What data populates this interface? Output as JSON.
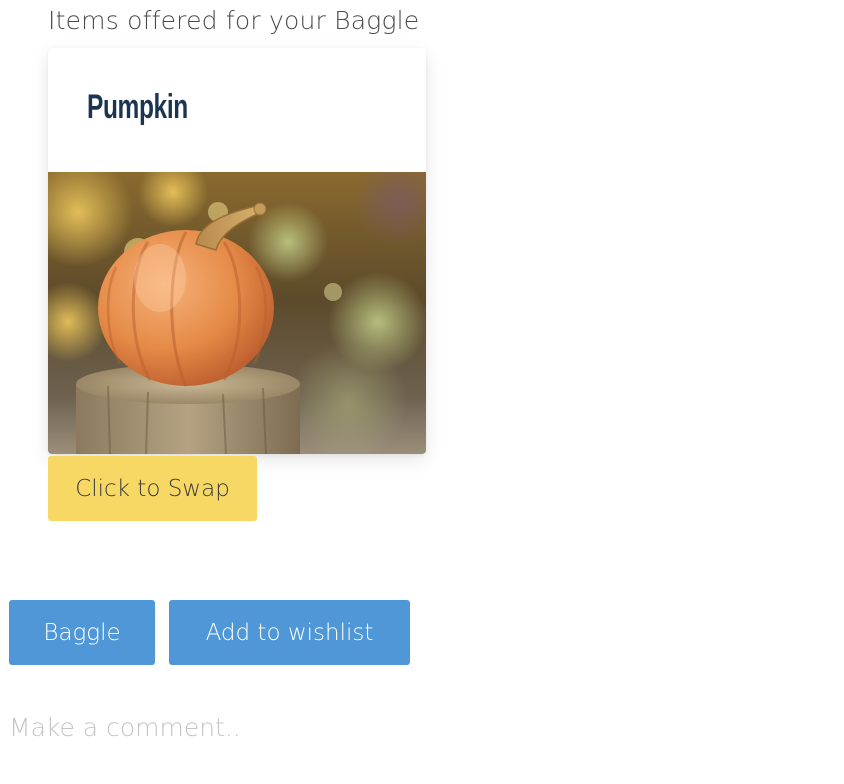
{
  "offered_items": {
    "heading": "Items offered for your Baggle",
    "items": [
      {
        "title": "Pumpkin",
        "photo": "pumpkin-on-wooden-stump-photo",
        "swap_label": "Click to Swap"
      }
    ]
  },
  "actions": {
    "baggle_label": "Baggle",
    "wishlist_label": "Add to wishlist"
  },
  "comment": {
    "placeholder": "Make a comment..",
    "value": ""
  },
  "colors": {
    "swap_button": "#f7d864",
    "primary_button": "#4f97d6",
    "item_title": "#1b3550",
    "heading_text": "#4a4a4a",
    "placeholder_text": "#c4c4c4"
  }
}
